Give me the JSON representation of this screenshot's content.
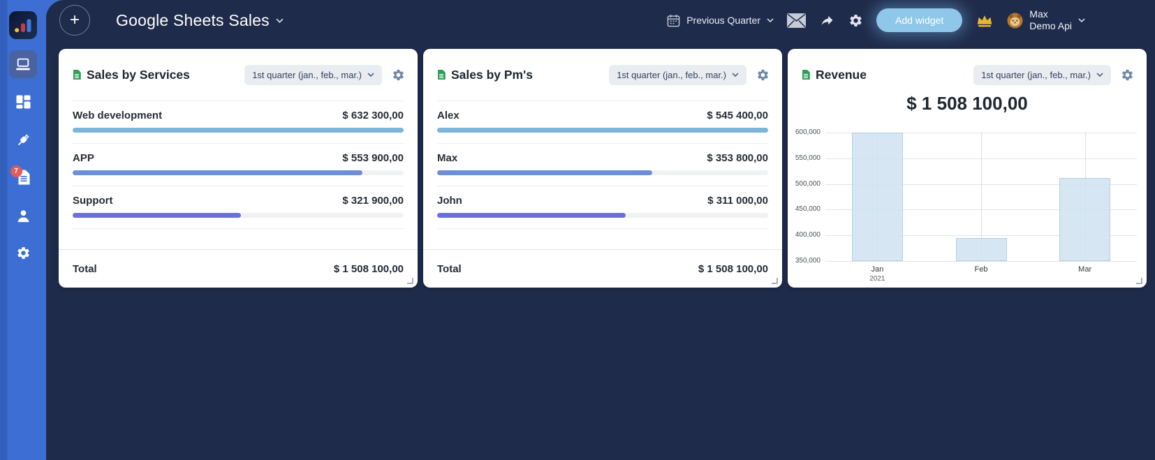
{
  "theme": {
    "sidebar_color": "#3c6ed3",
    "background_color": "#1f2b4b",
    "accent_button_color": "#8fc7ea",
    "bar_track_color": "#f1f2f4"
  },
  "sidebar": {
    "notification_badge": "7"
  },
  "header": {
    "new_button_glyph": "+",
    "title": "Google Sheets Sales",
    "period_button_label": "Previous Quarter",
    "add_widget_label": "Add widget",
    "user_name": "Max",
    "user_org": "Demo Api"
  },
  "cards": [
    {
      "title": "Sales by Services",
      "period": "1st quarter (jan., feb., mar.)",
      "rows": [
        {
          "label": "Web development",
          "value": "$ 632 300,00",
          "amount": 632300,
          "color": "#7db4da"
        },
        {
          "label": "APP",
          "value": "$ 553 900,00",
          "amount": 553900,
          "color": "#6d8edb"
        },
        {
          "label": "Support",
          "value": "$ 321 900,00",
          "amount": 321900,
          "color": "#6c71d9"
        }
      ],
      "total_label": "Total",
      "total_value": "$ 1 508 100,00"
    },
    {
      "title": "Sales by Pm's",
      "period": "1st quarter (jan., feb., mar.)",
      "rows": [
        {
          "label": "Alex",
          "value": "$ 545 400,00",
          "amount": 545400,
          "color": "#7db4da"
        },
        {
          "label": "Max",
          "value": "$ 353 800,00",
          "amount": 353800,
          "color": "#6d8edb"
        },
        {
          "label": "John",
          "value": "$ 311 000,00",
          "amount": 311000,
          "color": "#6c71d9"
        }
      ],
      "total_label": "Total",
      "total_value": "$ 1 508 100,00"
    }
  ],
  "revenue": {
    "title": "Revenue",
    "period": "1st quarter (jan., feb., mar.)",
    "total_display": "$ 1 508 100,00"
  },
  "chart_data": {
    "type": "bar",
    "title": "Revenue",
    "categories": [
      "Jan",
      "Feb",
      "Mar"
    ],
    "category_sublabels": [
      "2021",
      "",
      ""
    ],
    "values": [
      600000,
      395000,
      512000
    ],
    "ylim": [
      350000,
      600000
    ],
    "ytick_values": [
      350000,
      400000,
      450000,
      500000,
      550000,
      600000
    ],
    "ytick_labels": [
      "350,000",
      "400,000",
      "450,000",
      "500,000",
      "550,000",
      "600,000"
    ],
    "grid": true,
    "legend_position": "none",
    "bar_fill": "#cfe3f2",
    "bar_border": "#a8c9e0"
  }
}
